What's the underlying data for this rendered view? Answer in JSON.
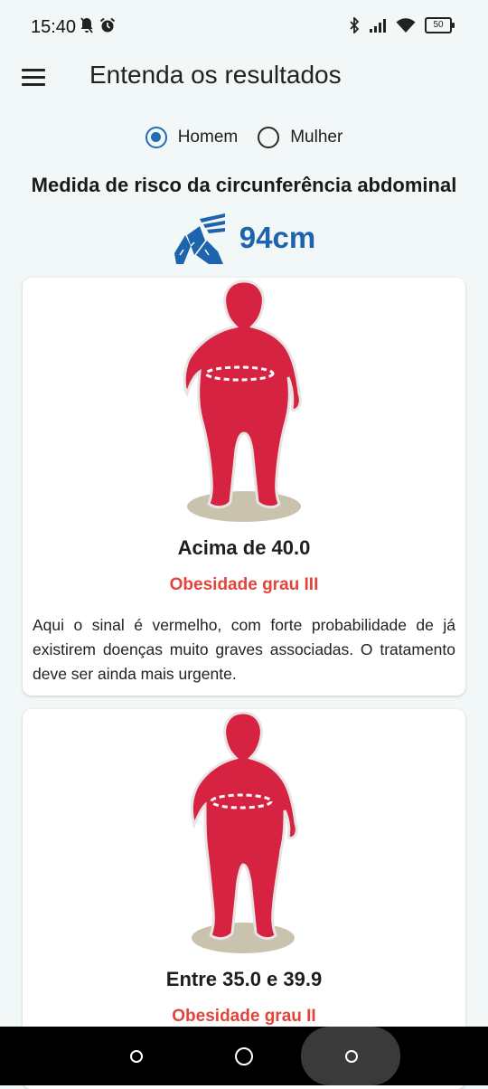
{
  "status": {
    "time": "15:40",
    "battery": "50"
  },
  "appbar": {
    "title": "Entenda os resultados"
  },
  "gender": {
    "options": [
      "Homem",
      "Mulher"
    ],
    "selected": "Homem"
  },
  "section": {
    "title": "Medida de risco da circunferência abdominal",
    "measure": "94cm"
  },
  "cards": [
    {
      "range": "Acima de 40.0",
      "classification": "Obesidade grau III",
      "description": "Aqui o sinal é vermelho, com forte probabilidade de já existirem doenças muito graves associadas. O tratamento deve ser ainda mais urgente.",
      "figure_color": "#d62341"
    },
    {
      "range": "Entre 35.0 e 39.9",
      "classification": "Obesidade grau II",
      "figure_color": "#d62341"
    }
  ],
  "colors": {
    "accent": "#1e64ad",
    "risk": "#e0443a",
    "background": "#f2f7f8"
  }
}
